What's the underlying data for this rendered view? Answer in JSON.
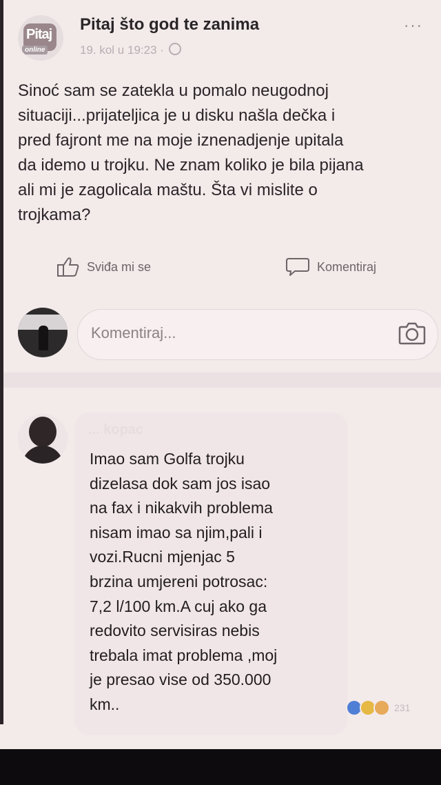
{
  "post": {
    "page_name": "Pitaj što god te zanima",
    "timestamp": "19. kol u 19:23 ·",
    "logo_text": "Pitaj",
    "logo_sub": "online",
    "more_label": "···",
    "text": "Sinoć sam se zatekla u pomalo neugodnoj\nsituaciji...prijateljica je u disku našla dečka i\npred fajront me na moje iznenadjenje upitala\nda idemo u trojku. Ne znam koliko je bila pijana\nali mi je zagolicala maštu. Šta vi mislite o\ntrojkama?"
  },
  "actions": {
    "like_label": "Sviđa mi se",
    "comment_label": "Komentiraj"
  },
  "composer": {
    "placeholder": "Komentiraj..."
  },
  "comment": {
    "author": "... kopac",
    "text": "Imao sam Golfa trojku\ndizelasa dok sam jos isao\nna fax i nikakvih problema\nnisam imao sa njim,pali i\nvozi.Rucni mjenjac 5\nbrzina umjereni potrosac:\n7,2 l/100 km.A cuj ako ga\nredovito servisiras nebis\ntrebala imat problema ,moj\nje presao vise od 350.000\nkm..",
    "reaction_count": "231"
  },
  "icons": {
    "like": "thumbs-up-icon",
    "comment": "speech-bubble-icon",
    "camera": "camera-icon",
    "globe": "globe-icon",
    "more": "more-icon"
  }
}
